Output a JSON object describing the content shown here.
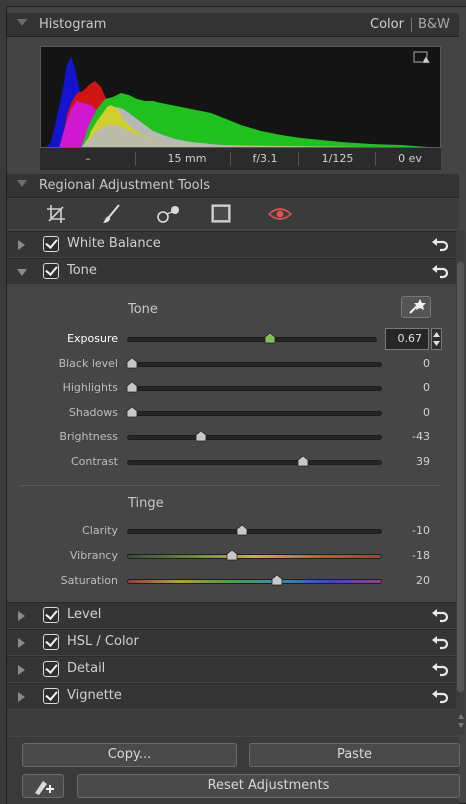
{
  "histogram": {
    "title": "Histogram",
    "mode_color": "Color",
    "mode_bw": "B&W",
    "exif": {
      "lens": "–",
      "focal": "15 mm",
      "aperture": "f/3.1",
      "shutter": "1/125",
      "ev": "0 ev"
    }
  },
  "regional_tools": {
    "title": "Regional Adjustment Tools",
    "tools": [
      "crop-icon",
      "brush-icon",
      "gradient-icon",
      "mask-icon",
      "eye-icon"
    ]
  },
  "sections": {
    "white_balance": "White Balance",
    "tone": "Tone",
    "level": "Level",
    "hsl": "HSL / Color",
    "detail": "Detail",
    "vignette": "Vignette"
  },
  "tone": {
    "group_title": "Tone",
    "exposure_value": "0.67",
    "sliders": [
      {
        "label": "Exposure",
        "value": "0.67",
        "pos": 0.57
      },
      {
        "label": "Black level",
        "value": "0",
        "pos": 0.02
      },
      {
        "label": "Highlights",
        "value": "0",
        "pos": 0.02
      },
      {
        "label": "Shadows",
        "value": "0",
        "pos": 0.02
      },
      {
        "label": "Brightness",
        "value": "-43",
        "pos": 0.29
      },
      {
        "label": "Contrast",
        "value": "39",
        "pos": 0.69
      }
    ]
  },
  "tinge": {
    "group_title": "Tinge",
    "sliders": [
      {
        "label": "Clarity",
        "value": "-10",
        "pos": 0.45
      },
      {
        "label": "Vibrancy",
        "value": "-18",
        "pos": 0.41
      },
      {
        "label": "Saturation",
        "value": "20",
        "pos": 0.59
      }
    ]
  },
  "buttons": {
    "copy": "Copy...",
    "paste": "Paste",
    "reset": "Reset Adjustments"
  },
  "colors": {
    "accent_thumb": "#7ec05a",
    "panel_bg": "#444444",
    "header_bg": "#333333"
  }
}
